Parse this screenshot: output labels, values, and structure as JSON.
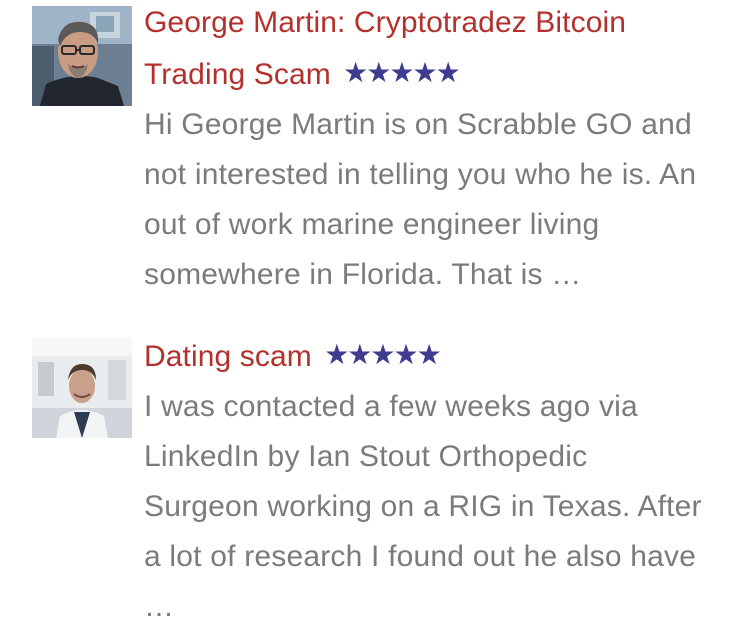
{
  "reviews": [
    {
      "avatar": "man-with-glasses-and-goatee-portrait",
      "title": "George Martin: Cryptotradez Bitcoin Trading Scam",
      "stars": "★★★★★",
      "rating": 5,
      "excerpt": "Hi George Martin is on Scrabble GO and not interested in telling you who he is. An out of work marine engineer living somewhere in Florida. That is …"
    },
    {
      "avatar": "man-in-white-coat-portrait",
      "title": "Dating scam",
      "stars": "★★★★★",
      "rating": 5,
      "excerpt": "I was contacted a few weeks ago via LinkedIn by Ian Stout Orthopedic Surgeon working on a RIG in Texas. After a lot of research I found out he also have …"
    }
  ],
  "colors": {
    "title": "#b3312c",
    "stars": "#3f3b8f",
    "excerpt": "#7b7b7b",
    "background": "#ffffff"
  }
}
